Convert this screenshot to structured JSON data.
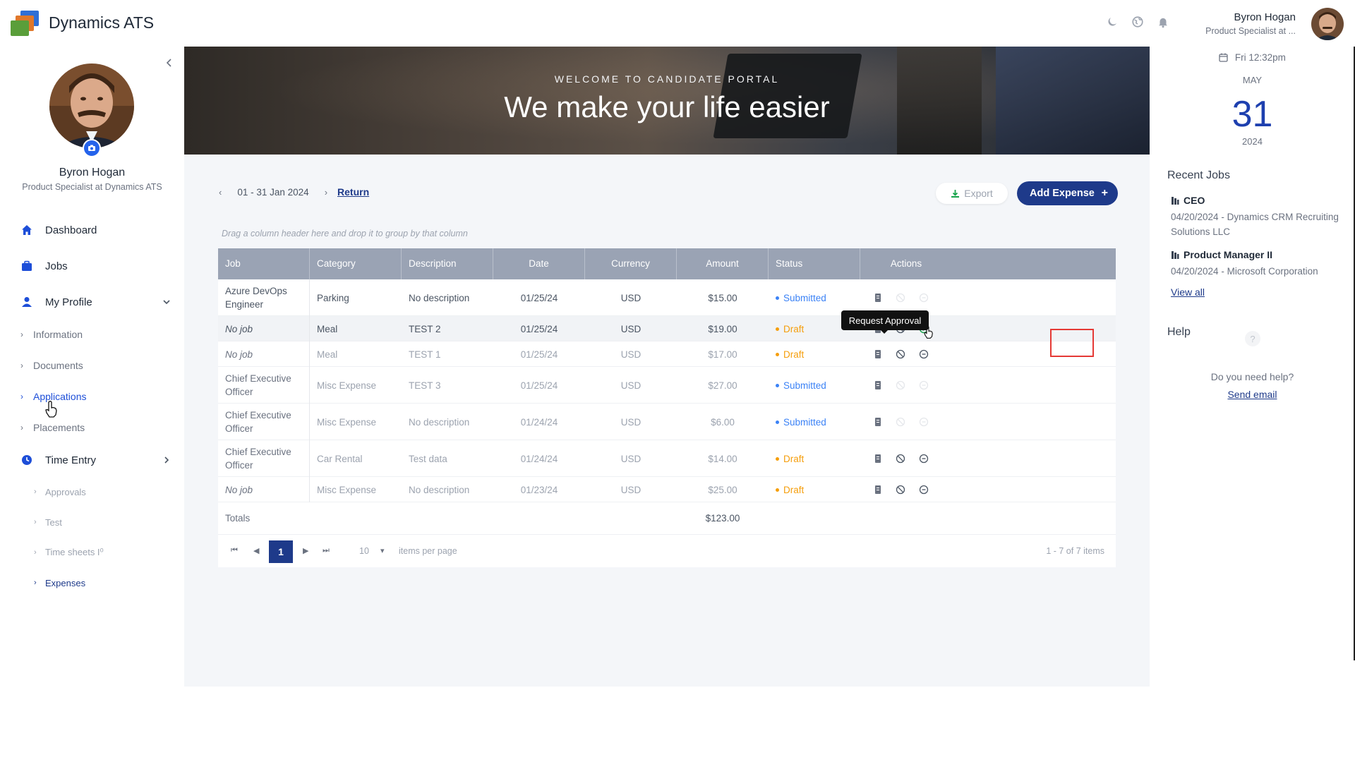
{
  "app": {
    "title": "Dynamics ATS"
  },
  "user": {
    "name": "Byron Hogan",
    "role_short": "Product Specialist at ...",
    "role_full": "Product Specialist at Dynamics ATS"
  },
  "sidebar": {
    "items": [
      {
        "label": "Dashboard",
        "icon": "home-icon"
      },
      {
        "label": "Jobs",
        "icon": "briefcase-icon"
      },
      {
        "label": "My Profile",
        "icon": "user-icon"
      },
      {
        "label": "Time Entry",
        "icon": "clock-icon"
      }
    ],
    "profile_sub": [
      "Information",
      "Documents",
      "Applications",
      "Placements"
    ],
    "time_sub": [
      "Approvals",
      "Test",
      "Time sheets I⁰",
      "Expenses"
    ]
  },
  "banner": {
    "subtitle": "WELCOME TO CANDIDATE PORTAL",
    "title": "We make your life easier"
  },
  "toolbar": {
    "prev": "‹",
    "next": "›",
    "date_range": "01 - 31 Jan 2024",
    "return_label": "Return",
    "export_label": "Export",
    "add_label": "Add Expense",
    "add_plus": "+"
  },
  "grid": {
    "group_hint": "Drag a column header here and drop it to group by that column",
    "columns": [
      "Job",
      "Category",
      "Description",
      "Date",
      "Currency",
      "Amount",
      "Status",
      "Actions"
    ],
    "rows": [
      {
        "job": "Azure DevOps Engineer",
        "category": "Parking",
        "description": "No description",
        "date": "01/25/24",
        "currency": "USD",
        "amount": "$15.00",
        "status": "Submitted"
      },
      {
        "job": "No job",
        "category": "Meal",
        "description": "TEST 2",
        "date": "01/25/24",
        "currency": "USD",
        "amount": "$19.00",
        "status": "Draft"
      },
      {
        "job": "No job",
        "category": "Meal",
        "description": "TEST 1",
        "date": "01/25/24",
        "currency": "USD",
        "amount": "$17.00",
        "status": "Draft"
      },
      {
        "job": "Chief Executive Officer",
        "category": "Misc Expense",
        "description": "TEST 3",
        "date": "01/25/24",
        "currency": "USD",
        "amount": "$27.00",
        "status": "Submitted"
      },
      {
        "job": "Chief Executive Officer",
        "category": "Misc Expense",
        "description": "No description",
        "date": "01/24/24",
        "currency": "USD",
        "amount": "$6.00",
        "status": "Submitted"
      },
      {
        "job": "Chief Executive Officer",
        "category": "Car Rental",
        "description": "Test data",
        "date": "01/24/24",
        "currency": "USD",
        "amount": "$14.00",
        "status": "Draft"
      },
      {
        "job": "No job",
        "category": "Misc Expense",
        "description": "No description",
        "date": "01/23/24",
        "currency": "USD",
        "amount": "$25.00",
        "status": "Draft"
      }
    ],
    "totals_label": "Totals",
    "totals_amount": "$123.00",
    "pager": {
      "current": "1",
      "page_size": "10",
      "per_page_label": "items per page",
      "summary": "1 - 7 of 7 items"
    }
  },
  "tooltip": {
    "label": "Request Approval"
  },
  "right_panel": {
    "clock": "Fri 12:32pm",
    "month": "MAY",
    "day": "31",
    "year": "2024",
    "recent_jobs_title": "Recent Jobs",
    "jobs": [
      {
        "title": "CEO",
        "date": "04/20/2024",
        "company": "Dynamics CRM Recruiting Solutions LLC"
      },
      {
        "title": "Product Manager II",
        "date": "04/20/2024",
        "company": "Microsoft Corporation"
      }
    ],
    "view_all": "View all",
    "help_title": "Help",
    "help_text": "Do you need help?",
    "send_email": "Send email"
  },
  "colors": {
    "primary": "#1e3a8a",
    "submitted": "#3b82f6",
    "draft": "#f59e0b",
    "header": "#9aa3b4",
    "highlight": "#e53935"
  }
}
